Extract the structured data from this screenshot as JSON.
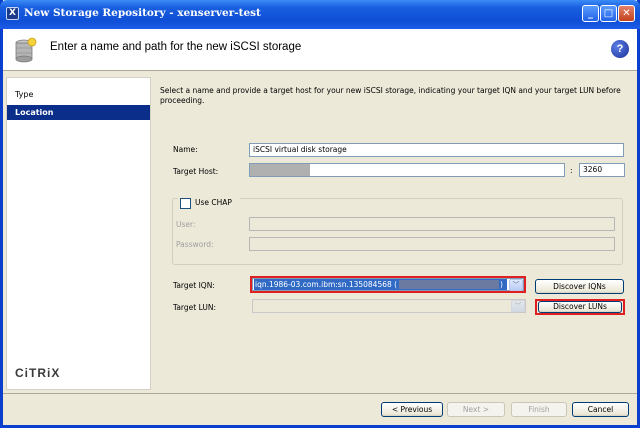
{
  "window": {
    "title": "New Storage Repository - xenserver-test",
    "app_icon": "X",
    "controls": {
      "minimize": "_",
      "maximize": "□",
      "close": "✕"
    }
  },
  "header": {
    "icon": "storage-icon",
    "title": "Enter a name and path for the new iSCSI storage",
    "help": "?"
  },
  "sidebar": {
    "items": [
      {
        "label": "Type",
        "selected": false
      },
      {
        "label": "Location",
        "selected": true
      }
    ],
    "logo": "CiTRiX"
  },
  "main": {
    "instructions": "Select a name and provide a target host for your new iSCSI storage, indicating your target IQN and your target LUN before proceeding.",
    "name_label": "Name:",
    "name_value": "iSCSI virtual disk storage",
    "host_label": "Target Host:",
    "host_value": "",
    "port_separator": ":",
    "port_value": "3260",
    "chap": {
      "label": "Use CHAP",
      "checked": false,
      "user_label": "User:",
      "password_label": "Password:"
    },
    "iqn_label": "Target IQN:",
    "iqn_value": "iqn.1986-03.com.ibm:sn.135084568 (",
    "iqn_value_end": ")",
    "discover_iqns": "Discover IQNs",
    "lun_label": "Target LUN:",
    "discover_luns": "Discover LUNs",
    "dropdown_arrow": "﹀"
  },
  "footer": {
    "previous": "< Previous",
    "next": "Next >",
    "finish": "Finish",
    "cancel": "Cancel"
  },
  "colors": {
    "selection": "#0b2e8a",
    "highlight_box": "#e02020",
    "titlebar": "#0f4fd6"
  }
}
